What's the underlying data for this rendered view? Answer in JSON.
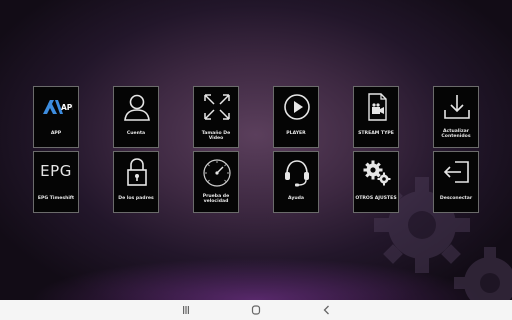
{
  "tiles": [
    {
      "key": "app",
      "label": "APP",
      "icon": "app-logo-icon"
    },
    {
      "key": "cuenta",
      "label": "Cuenta",
      "icon": "user-icon"
    },
    {
      "key": "tamano",
      "label": "Tamaño De Video",
      "icon": "expand-arrows-icon"
    },
    {
      "key": "player",
      "label": "PLAYER",
      "icon": "play-icon"
    },
    {
      "key": "stream",
      "label": "STREAM TYPE",
      "icon": "video-file-icon"
    },
    {
      "key": "actualizar",
      "label": "Actualizar Contenidos",
      "icon": "download-icon"
    },
    {
      "key": "epg",
      "label": "EPG Timeshift",
      "icon": "epg-text-icon",
      "icon_text": "EPG"
    },
    {
      "key": "padres",
      "label": "De los padres",
      "icon": "lock-icon"
    },
    {
      "key": "velocidad",
      "label": "Prueba de velocidad",
      "icon": "speedometer-icon"
    },
    {
      "key": "ayuda",
      "label": "Ayuda",
      "icon": "headset-icon"
    },
    {
      "key": "ajustes",
      "label": "OTROS AJUSTES",
      "icon": "gears-icon"
    },
    {
      "key": "desconectar",
      "label": "Desconectar",
      "icon": "logout-icon"
    }
  ],
  "app_logo_text": "APP",
  "navbar": {
    "buttons": [
      "recents-icon",
      "home-icon",
      "back-icon"
    ]
  },
  "colors": {
    "tile_bg": "#050505",
    "tile_border": "#6b6b6b",
    "label": "#e8e8e8",
    "navbar": "#f5f5f5"
  }
}
